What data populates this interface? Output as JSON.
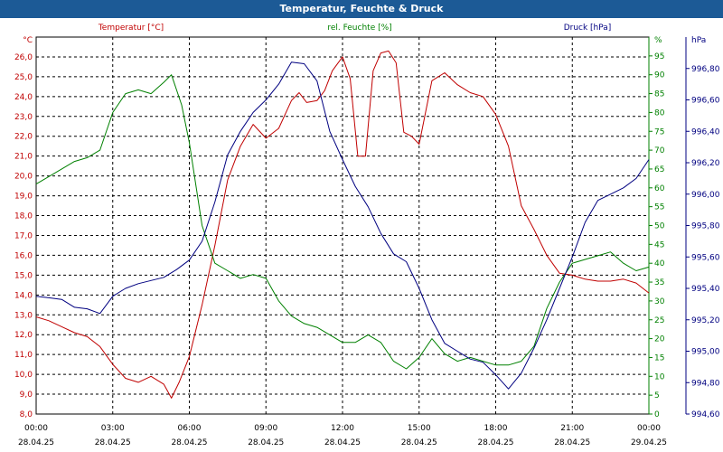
{
  "window": {
    "title": "Temperatur, Feuchte & Druck"
  },
  "chart_data": {
    "type": "line",
    "title": "Temperatur, Feuchte & Druck",
    "colors": {
      "temperature": "#c00000",
      "humidity": "#008000",
      "pressure": "#000080",
      "grid": "#000000",
      "background": "#ffffff"
    },
    "grid": true,
    "x_ticks": [
      {
        "time": "00:00",
        "date": "28.04.25"
      },
      {
        "time": "03:00",
        "date": "28.04.25"
      },
      {
        "time": "06:00",
        "date": "28.04.25"
      },
      {
        "time": "09:00",
        "date": "28.04.25"
      },
      {
        "time": "12:00",
        "date": "28.04.25"
      },
      {
        "time": "15:00",
        "date": "28.04.25"
      },
      {
        "time": "18:00",
        "date": "28.04.25"
      },
      {
        "time": "21:00",
        "date": "28.04.25"
      },
      {
        "time": "00:00",
        "date": "29.04.25"
      }
    ],
    "axes": {
      "temperature": {
        "unit": "°C",
        "series_label": "Temperatur [°C]",
        "ylim": [
          8.0,
          27.0
        ],
        "ticks": [
          "8,0",
          "9,0",
          "10,0",
          "11,0",
          "12,0",
          "13,0",
          "14,0",
          "15,0",
          "16,0",
          "17,0",
          "18,0",
          "19,0",
          "20,0",
          "21,0",
          "22,0",
          "23,0",
          "24,0",
          "25,0",
          "26,0"
        ]
      },
      "humidity": {
        "unit": "%",
        "series_label": "rel. Feuchte [%]",
        "ylim": [
          0,
          100
        ],
        "ticks": [
          "0",
          "5",
          "10",
          "15",
          "20",
          "25",
          "30",
          "35",
          "40",
          "45",
          "50",
          "55",
          "60",
          "65",
          "70",
          "75",
          "80",
          "85",
          "90",
          "95"
        ]
      },
      "pressure": {
        "unit": "hPa",
        "series_label": "Druck [hPa]",
        "ylim": [
          994.6,
          997.0
        ],
        "ticks": [
          "994,60",
          "994,80",
          "995,00",
          "995,20",
          "995,40",
          "995,60",
          "995,80",
          "996,00",
          "996,20",
          "996,40",
          "996,60",
          "996,80"
        ]
      }
    },
    "series": [
      {
        "name": "Temperatur [°C]",
        "axis": "temperature",
        "x": [
          0,
          0.5,
          1,
          1.5,
          2,
          2.5,
          3,
          3.5,
          4,
          4.5,
          5,
          5.3,
          5.6,
          6,
          6.5,
          7,
          7.5,
          8,
          8.5,
          9,
          9.5,
          10,
          10.3,
          10.6,
          11,
          11.3,
          11.6,
          12,
          12.3,
          12.6,
          12.9,
          13.2,
          13.5,
          13.8,
          14.1,
          14.4,
          14.7,
          15,
          15.5,
          16,
          16.5,
          17,
          17.5,
          18,
          18.5,
          19,
          19.5,
          20,
          20.5,
          21,
          21.5,
          22,
          22.5,
          23,
          23.5,
          24
        ],
        "values": [
          12.9,
          12.7,
          12.4,
          12.1,
          11.9,
          11.4,
          10.5,
          9.8,
          9.6,
          9.9,
          9.5,
          8.8,
          9.6,
          10.9,
          13.5,
          16.5,
          19.8,
          21.5,
          22.6,
          21.9,
          22.4,
          23.8,
          24.2,
          23.7,
          23.8,
          24.3,
          25.3,
          26.0,
          24.9,
          21.0,
          21.0,
          25.3,
          26.2,
          26.3,
          25.7,
          22.2,
          22.0,
          21.6,
          24.8,
          25.2,
          24.6,
          24.2,
          24.0,
          23.1,
          21.5,
          18.5,
          17.3,
          16.0,
          15.1,
          15.0,
          14.8,
          14.7,
          14.7,
          14.8,
          14.6,
          14.1
        ]
      },
      {
        "name": "rel. Feuchte [%]",
        "axis": "humidity",
        "x": [
          0,
          0.5,
          1,
          1.5,
          2,
          2.5,
          3,
          3.5,
          4,
          4.5,
          5,
          5.3,
          5.7,
          6,
          6.5,
          7,
          7.5,
          8,
          8.5,
          9,
          9.5,
          10,
          10.5,
          11,
          11.5,
          12,
          12.5,
          13,
          13.5,
          14,
          14.5,
          15,
          15.5,
          16,
          16.5,
          17,
          17.5,
          18,
          18.5,
          19,
          19.5,
          20,
          20.5,
          21,
          21.5,
          22,
          22.5,
          23,
          23.5,
          24
        ],
        "values": [
          61,
          63,
          65,
          67,
          68,
          70,
          80,
          85,
          86,
          85,
          88,
          90,
          82,
          72,
          50,
          40,
          38,
          36,
          37,
          36,
          30,
          26,
          24,
          23,
          21,
          19,
          19,
          21,
          19,
          14,
          12,
          15,
          20,
          16,
          14,
          15,
          14,
          13,
          13,
          14,
          18,
          28,
          35,
          40,
          41,
          42,
          43,
          40,
          38,
          39
        ]
      },
      {
        "name": "Druck [hPa]",
        "axis": "pressure",
        "x": [
          0,
          0.5,
          1,
          1.5,
          2,
          2.5,
          3,
          3.5,
          4,
          4.5,
          5,
          5.5,
          6,
          6.5,
          7,
          7.5,
          8,
          8.5,
          9,
          9.5,
          10,
          10.5,
          11,
          11.5,
          12,
          12.5,
          13,
          13.5,
          14,
          14.5,
          15,
          15.5,
          16,
          16.5,
          17,
          17.5,
          18,
          18.5,
          19,
          19.5,
          20,
          20.5,
          21,
          21.5,
          22,
          22.5,
          23,
          23.5,
          24
        ],
        "values": [
          995.35,
          995.34,
          995.33,
          995.28,
          995.27,
          995.24,
          995.35,
          995.4,
          995.43,
          995.45,
          995.47,
          995.52,
          995.58,
          995.7,
          995.95,
          996.25,
          996.4,
          996.52,
          996.6,
          996.7,
          996.84,
          996.83,
          996.72,
          996.4,
          996.22,
          996.05,
          995.92,
          995.75,
          995.62,
          995.57,
          995.4,
          995.2,
          995.05,
          995.0,
          994.95,
          994.93,
          994.85,
          994.76,
          994.86,
          995.02,
          995.2,
          995.4,
          995.6,
          995.82,
          995.96,
          996.0,
          996.04,
          996.1,
          996.22
        ]
      }
    ]
  }
}
